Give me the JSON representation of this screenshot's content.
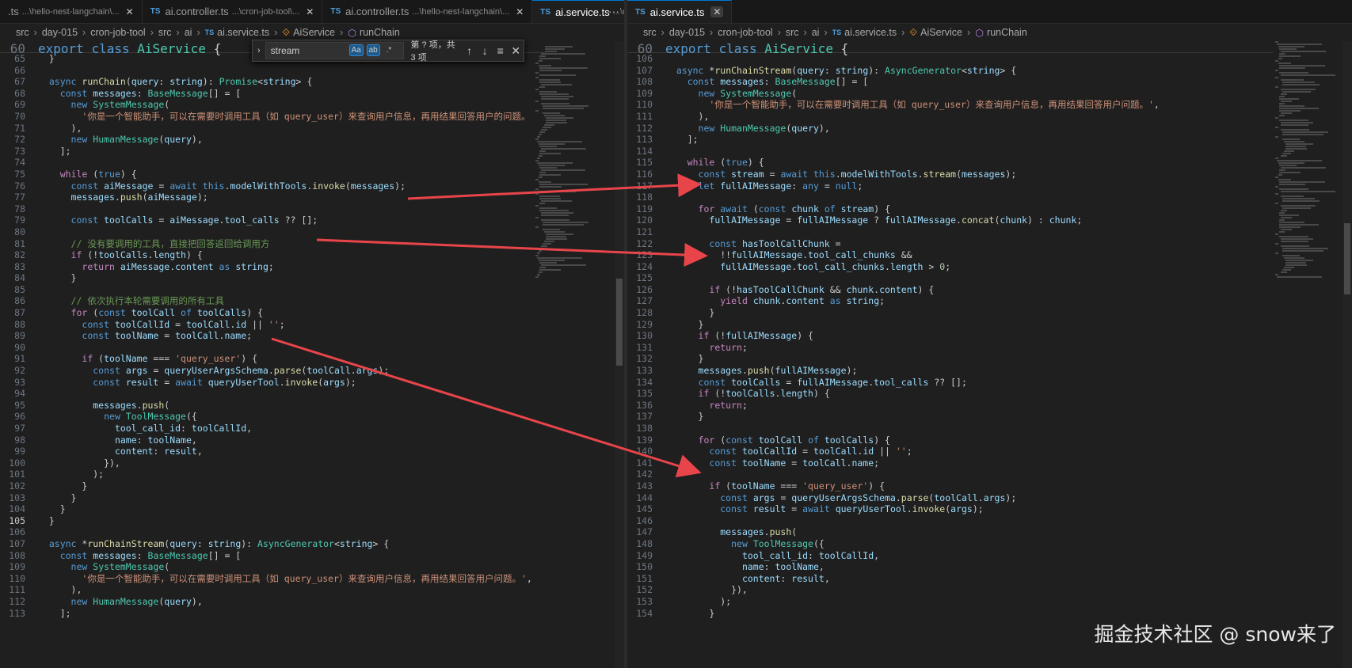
{
  "left_pane": {
    "tabs": [
      {
        "prefix": "",
        "label": ".ts",
        "desc": "...\\hello-nest-langchain\\...",
        "active": false
      },
      {
        "prefix": "TS",
        "label": "ai.controller.ts",
        "desc": "...\\cron-job-tool\\...",
        "active": false
      },
      {
        "prefix": "TS",
        "label": "ai.controller.ts",
        "desc": "...\\hello-nest-langchain\\...",
        "active": false
      },
      {
        "prefix": "TS",
        "label": "ai.service.ts",
        "desc": "...\\cron-job-tool\\...",
        "active": true
      }
    ],
    "more_label": "···",
    "breadcrumb": [
      "src",
      "day-015",
      "cron-job-tool",
      "src",
      "ai",
      "ai.service.ts",
      "AiService",
      "runChain"
    ],
    "sticky": {
      "num": "60",
      "text": "export class AiService {"
    },
    "find": {
      "query": "stream",
      "case_label": "Aa",
      "word_label": "ab",
      "regex_label": ".*",
      "count": "第 ? 项，共 3 项",
      "prev": "↑",
      "next": "↓",
      "selection": "≡",
      "close": "✕",
      "toggle": "›"
    },
    "lines": [
      {
        "n": "65",
        "t": "  }"
      },
      {
        "n": "66",
        "t": ""
      },
      {
        "n": "67",
        "t": "  async runChain(query: string): Promise<string> {"
      },
      {
        "n": "68",
        "t": "    const messages: BaseMessage[] = ["
      },
      {
        "n": "69",
        "t": "      new SystemMessage("
      },
      {
        "n": "70",
        "t": "        '你是一个智能助手，可以在需要时调用工具（如 query_user）来查询用户信息，再用结果回答用户的问题。"
      },
      {
        "n": "71",
        "t": "      ),"
      },
      {
        "n": "72",
        "t": "      new HumanMessage(query),"
      },
      {
        "n": "73",
        "t": "    ];"
      },
      {
        "n": "74",
        "t": ""
      },
      {
        "n": "75",
        "t": "    while (true) {"
      },
      {
        "n": "76",
        "t": "      const aiMessage = await this.modelWithTools.invoke(messages);"
      },
      {
        "n": "77",
        "t": "      messages.push(aiMessage);"
      },
      {
        "n": "78",
        "t": ""
      },
      {
        "n": "79",
        "t": "      const toolCalls = aiMessage.tool_calls ?? [];"
      },
      {
        "n": "80",
        "t": ""
      },
      {
        "n": "81",
        "t": "      // 没有要调用的工具，直接把回答返回给调用方"
      },
      {
        "n": "82",
        "t": "      if (!toolCalls.length) {"
      },
      {
        "n": "83",
        "t": "        return aiMessage.content as string;"
      },
      {
        "n": "84",
        "t": "      }"
      },
      {
        "n": "85",
        "t": ""
      },
      {
        "n": "86",
        "t": "      // 依次执行本轮需要调用的所有工具"
      },
      {
        "n": "87",
        "t": "      for (const toolCall of toolCalls) {"
      },
      {
        "n": "88",
        "t": "        const toolCallId = toolCall.id || '';"
      },
      {
        "n": "89",
        "t": "        const toolName = toolCall.name;"
      },
      {
        "n": "90",
        "t": ""
      },
      {
        "n": "91",
        "t": "        if (toolName === 'query_user') {"
      },
      {
        "n": "92",
        "t": "          const args = queryUserArgsSchema.parse(toolCall.args);"
      },
      {
        "n": "93",
        "t": "          const result = await queryUserTool.invoke(args);"
      },
      {
        "n": "94",
        "t": ""
      },
      {
        "n": "95",
        "t": "          messages.push("
      },
      {
        "n": "96",
        "t": "            new ToolMessage({"
      },
      {
        "n": "97",
        "t": "              tool_call_id: toolCallId,"
      },
      {
        "n": "98",
        "t": "              name: toolName,"
      },
      {
        "n": "99",
        "t": "              content: result,"
      },
      {
        "n": "100",
        "t": "            }),"
      },
      {
        "n": "101",
        "t": "          );"
      },
      {
        "n": "102",
        "t": "        }"
      },
      {
        "n": "103",
        "t": "      }"
      },
      {
        "n": "104",
        "t": "    }"
      },
      {
        "n": "105",
        "t": "  }"
      },
      {
        "n": "106",
        "t": ""
      },
      {
        "n": "107",
        "t": "  async *runChainStream(query: string): AsyncGenerator<string> {"
      },
      {
        "n": "108",
        "t": "    const messages: BaseMessage[] = ["
      },
      {
        "n": "109",
        "t": "      new SystemMessage("
      },
      {
        "n": "110",
        "t": "        '你是一个智能助手，可以在需要时调用工具（如 query_user）来查询用户信息，再用结果回答用户问题。',"
      },
      {
        "n": "111",
        "t": "      ),"
      },
      {
        "n": "112",
        "t": "      new HumanMessage(query),"
      },
      {
        "n": "113",
        "t": "    ];"
      }
    ]
  },
  "right_pane": {
    "tabs": [
      {
        "prefix": "TS",
        "label": "ai.service.ts",
        "desc": "",
        "active": true
      }
    ],
    "breadcrumb": [
      "src",
      "day-015",
      "cron-job-tool",
      "src",
      "ai",
      "ai.service.ts",
      "AiService",
      "runChain"
    ],
    "sticky": {
      "num": "60",
      "text": "export class AiService {"
    },
    "lines": [
      {
        "n": "106",
        "t": ""
      },
      {
        "n": "107",
        "t": "  async *runChainStream(query: string): AsyncGenerator<string> {"
      },
      {
        "n": "108",
        "t": "    const messages: BaseMessage[] = ["
      },
      {
        "n": "109",
        "t": "      new SystemMessage("
      },
      {
        "n": "110",
        "t": "        '你是一个智能助手，可以在需要时调用工具（如 query_user）来查询用户信息，再用结果回答用户问题。',"
      },
      {
        "n": "111",
        "t": "      ),"
      },
      {
        "n": "112",
        "t": "      new HumanMessage(query),"
      },
      {
        "n": "113",
        "t": "    ];"
      },
      {
        "n": "114",
        "t": ""
      },
      {
        "n": "115",
        "t": "    while (true) {"
      },
      {
        "n": "116",
        "t": "      const stream = await this.modelWithTools.stream(messages);"
      },
      {
        "n": "117",
        "t": "      let fullAIMessage: any = null;"
      },
      {
        "n": "118",
        "t": ""
      },
      {
        "n": "119",
        "t": "      for await (const chunk of stream) {"
      },
      {
        "n": "120",
        "t": "        fullAIMessage = fullAIMessage ? fullAIMessage.concat(chunk) : chunk;"
      },
      {
        "n": "121",
        "t": ""
      },
      {
        "n": "122",
        "t": "        const hasToolCallChunk ="
      },
      {
        "n": "123",
        "t": "          !!fullAIMessage.tool_call_chunks &&"
      },
      {
        "n": "124",
        "t": "          fullAIMessage.tool_call_chunks.length > 0;"
      },
      {
        "n": "125",
        "t": ""
      },
      {
        "n": "126",
        "t": "        if (!hasToolCallChunk && chunk.content) {"
      },
      {
        "n": "127",
        "t": "          yield chunk.content as string;"
      },
      {
        "n": "128",
        "t": "        }"
      },
      {
        "n": "129",
        "t": "      }"
      },
      {
        "n": "130",
        "t": "      if (!fullAIMessage) {"
      },
      {
        "n": "131",
        "t": "        return;"
      },
      {
        "n": "132",
        "t": "      }"
      },
      {
        "n": "133",
        "t": "      messages.push(fullAIMessage);"
      },
      {
        "n": "134",
        "t": "      const toolCalls = fullAIMessage.tool_calls ?? [];"
      },
      {
        "n": "135",
        "t": "      if (!toolCalls.length) {"
      },
      {
        "n": "136",
        "t": "        return;"
      },
      {
        "n": "137",
        "t": "      }"
      },
      {
        "n": "138",
        "t": ""
      },
      {
        "n": "139",
        "t": "      for (const toolCall of toolCalls) {"
      },
      {
        "n": "140",
        "t": "        const toolCallId = toolCall.id || '';"
      },
      {
        "n": "141",
        "t": "        const toolName = toolCall.name;"
      },
      {
        "n": "142",
        "t": ""
      },
      {
        "n": "143",
        "t": "        if (toolName === 'query_user') {"
      },
      {
        "n": "144",
        "t": "          const args = queryUserArgsSchema.parse(toolCall.args);"
      },
      {
        "n": "145",
        "t": "          const result = await queryUserTool.invoke(args);"
      },
      {
        "n": "146",
        "t": ""
      },
      {
        "n": "147",
        "t": "          messages.push("
      },
      {
        "n": "148",
        "t": "            new ToolMessage({"
      },
      {
        "n": "149",
        "t": "              tool_call_id: toolCallId,"
      },
      {
        "n": "150",
        "t": "              name: toolName,"
      },
      {
        "n": "151",
        "t": "              content: result,"
      },
      {
        "n": "152",
        "t": "            }),"
      },
      {
        "n": "153",
        "t": "          );"
      },
      {
        "n": "154",
        "t": "        }"
      }
    ]
  },
  "watermark": "掘金技术社区 @ snow来了",
  "colors": {
    "editor_bg": "#1f1f1f",
    "arrow": "#e8454a",
    "keyword": "#569cd6",
    "control": "#c586c0",
    "string": "#ce9178",
    "comment": "#6a9955",
    "type": "#4ec9b0",
    "function": "#dcdcaa"
  },
  "icons": [
    "close-icon",
    "chevron-right-icon",
    "class-icon",
    "method-icon",
    "arrow-up-icon",
    "arrow-down-icon",
    "more-icon"
  ]
}
